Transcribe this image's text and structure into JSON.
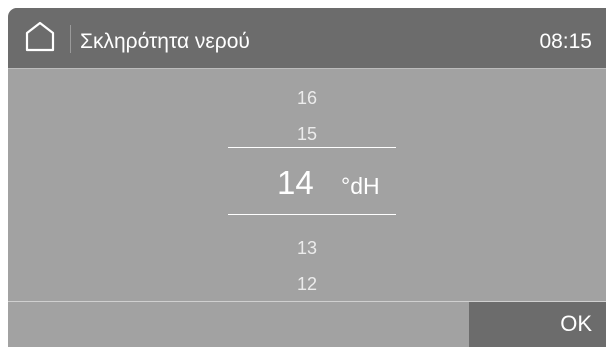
{
  "header": {
    "home_icon": "home-icon",
    "title": "Σκληρότητα νερού",
    "time": "08:15"
  },
  "picker": {
    "above": [
      "16",
      "15"
    ],
    "selected": "14",
    "unit": "°dH",
    "below": [
      "13",
      "12"
    ]
  },
  "footer": {
    "ok_label": "OK"
  },
  "colors": {
    "header_background": "#6c6c6c",
    "body_background": "#a2a2a2",
    "text": "#ffffff",
    "dim_text": "#ececec"
  }
}
